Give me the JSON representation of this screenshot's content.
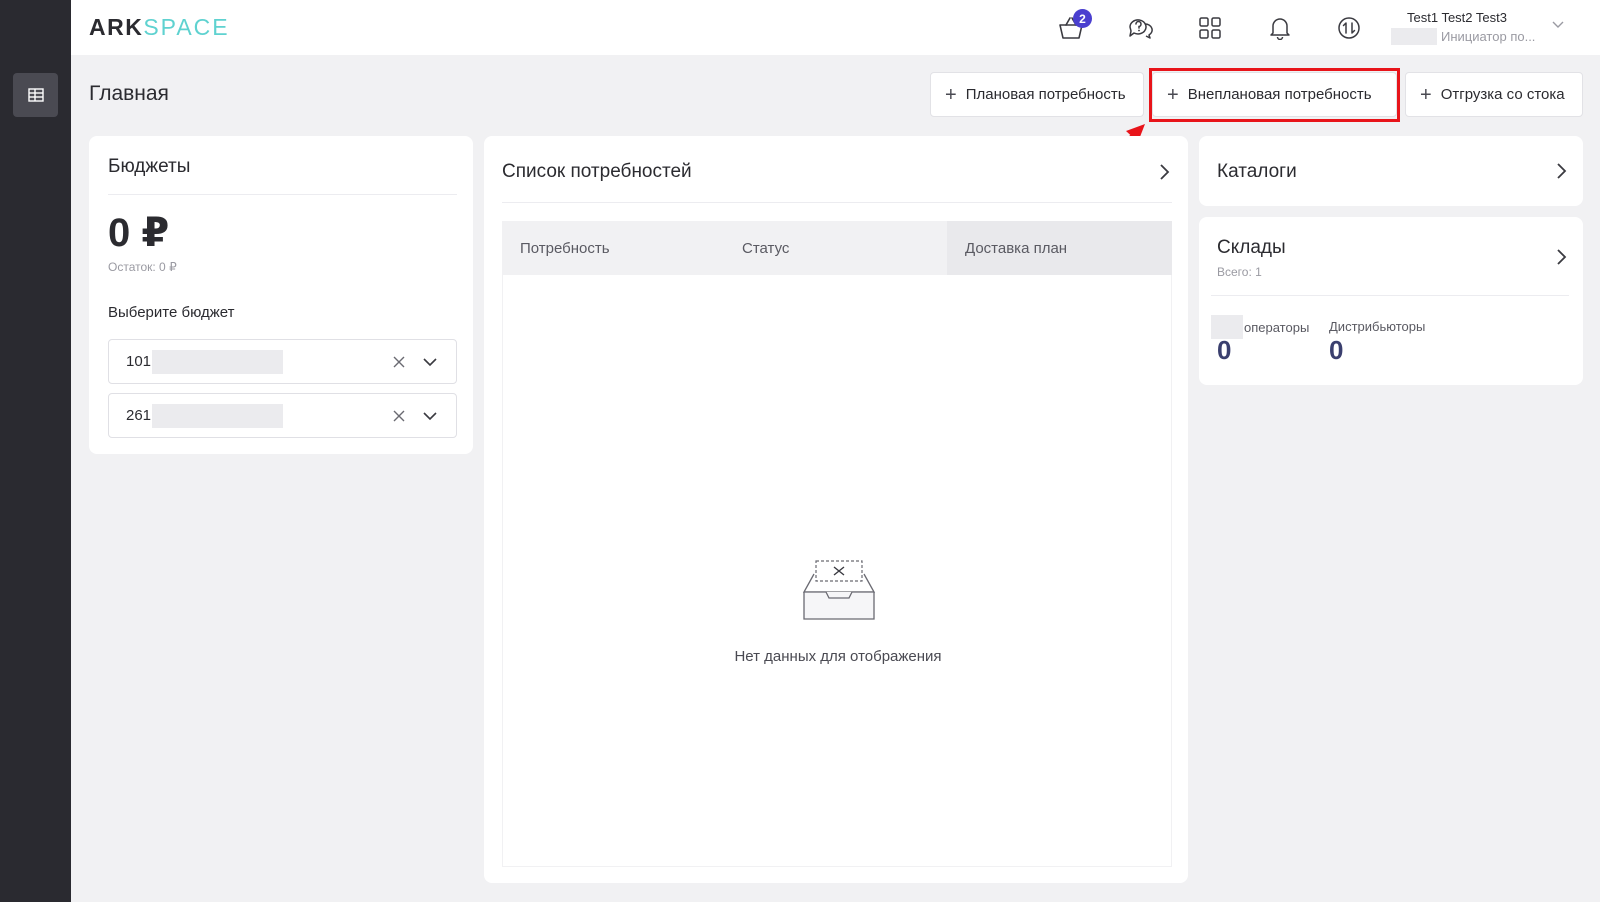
{
  "app": {
    "logo_left": "ARK",
    "logo_right": "SPACE"
  },
  "header": {
    "cart_badge": "2",
    "user_name": "Test1 Test2 Test3",
    "user_role": "Инициатор по..."
  },
  "page": {
    "title": "Главная"
  },
  "actions": {
    "planned": "Плановая потребность",
    "unplanned": "Внеплановая потребность",
    "stock": "Отгрузка со стока"
  },
  "budgets": {
    "title": "Бюджеты",
    "amount": "0 ₽",
    "rest": "Остаток: 0 ₽",
    "select_label": "Выберите бюджет",
    "selects": [
      {
        "value": "101"
      },
      {
        "value": "261"
      }
    ]
  },
  "needs": {
    "title": "Список потребностей",
    "columns": [
      "Потребность",
      "Статус",
      "Доставка план"
    ],
    "empty": "Нет данных для отображения"
  },
  "catalogs": {
    "title": "Каталоги"
  },
  "warehouses": {
    "title": "Склады",
    "subtitle": "Всего: 1",
    "stats": [
      {
        "label": "операторы",
        "value": "0"
      },
      {
        "label": "Дистрибьюторы",
        "value": "0"
      }
    ]
  },
  "icons": {
    "sidebar": "table-icon",
    "cart": "basket-icon",
    "support": "chat-question-icon",
    "apps": "grid-icon",
    "notifications": "bell-icon",
    "switch": "exchange-icon"
  },
  "colors": {
    "accent": "#4a3fcf",
    "logo_accent": "#5fd2d0",
    "highlight": "#e8141a",
    "sidebar": "#2a2a30"
  }
}
